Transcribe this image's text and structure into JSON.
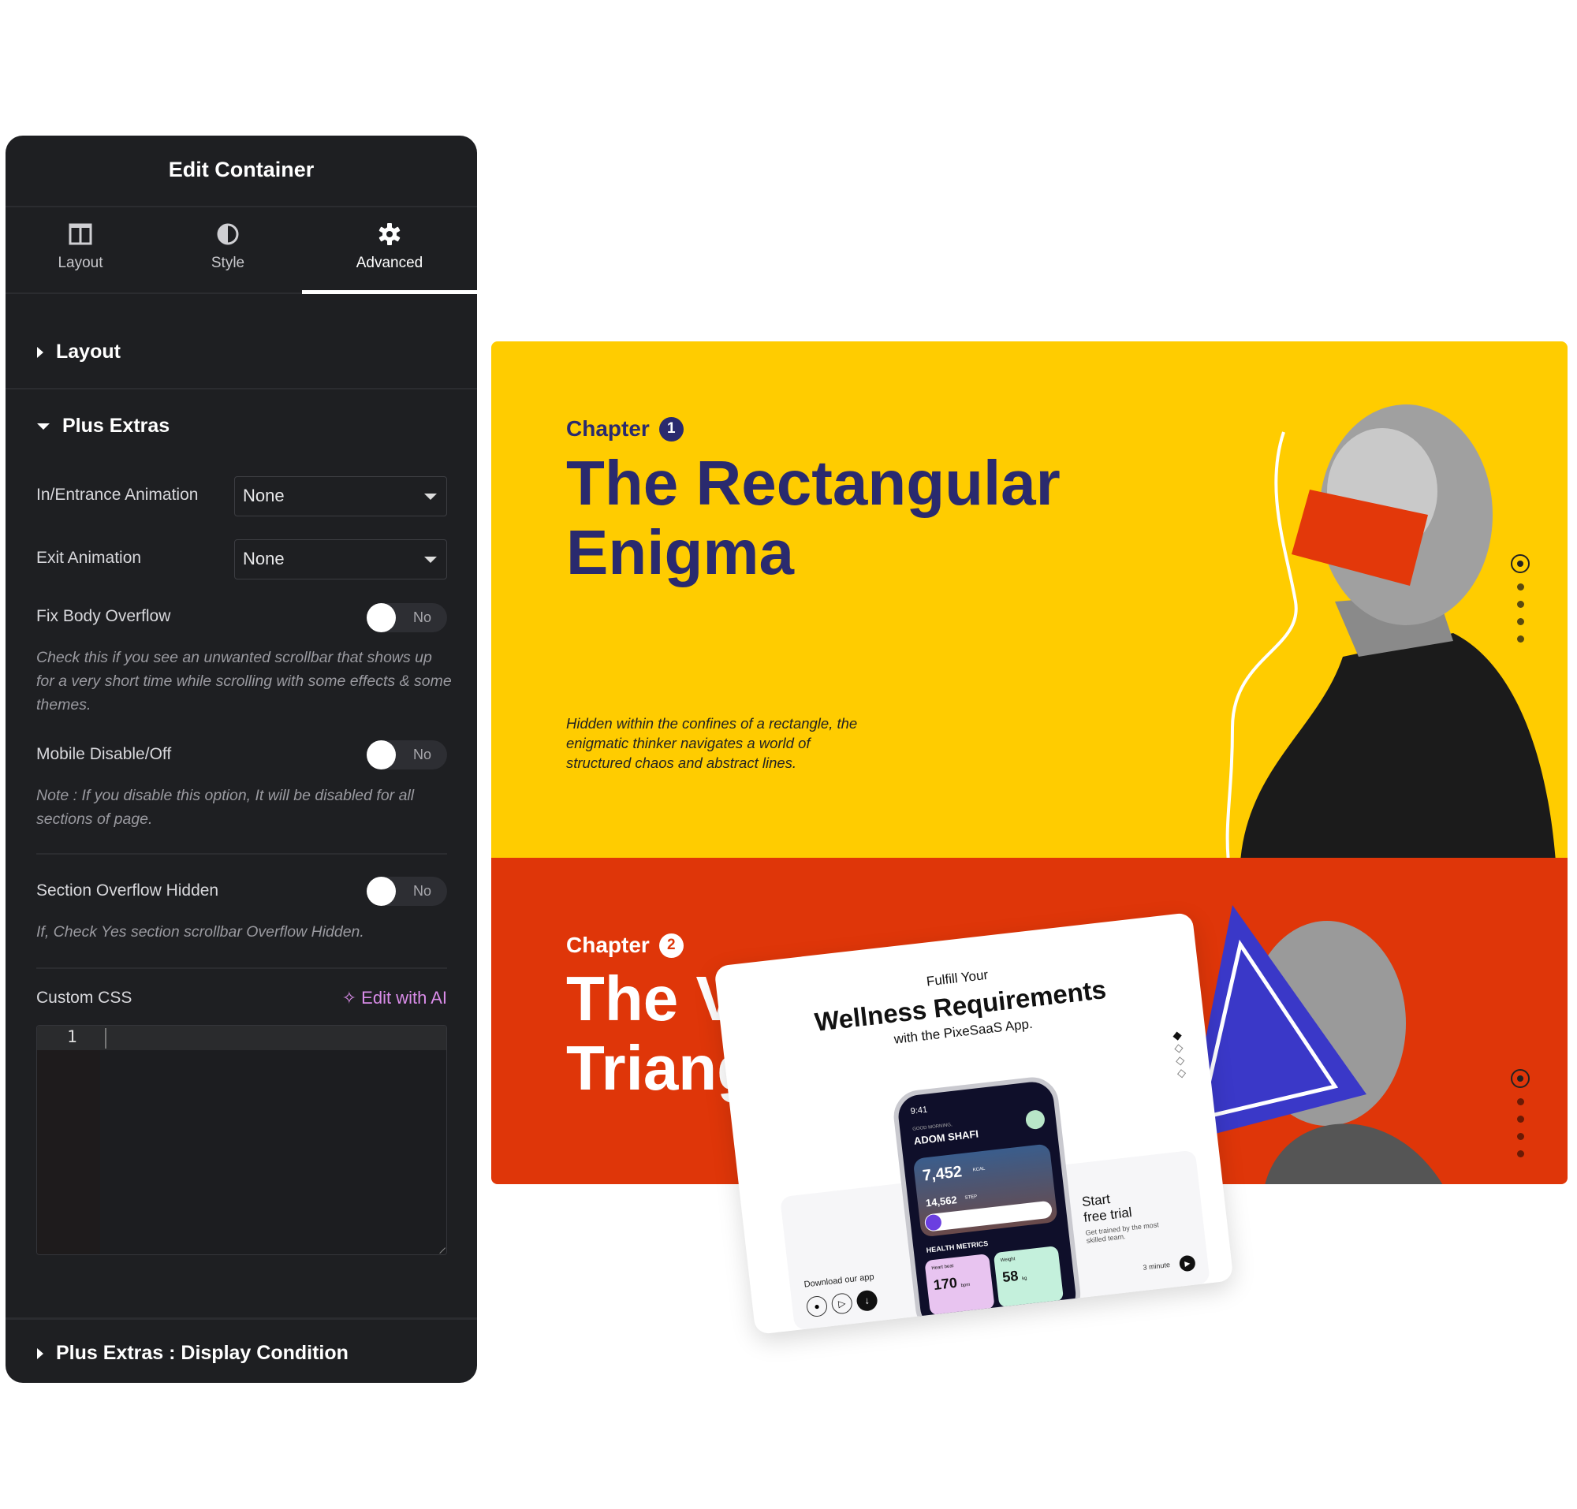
{
  "panel": {
    "title": "Edit Container",
    "tabs": [
      {
        "label": "Layout",
        "icon": "columns-icon"
      },
      {
        "label": "Style",
        "icon": "half-circle-icon"
      },
      {
        "label": "Advanced",
        "icon": "gear-icon",
        "active": true
      }
    ],
    "sections": {
      "layout": "Layout",
      "plus_extras": "Plus Extras",
      "display_condition": "Plus Extras : Display Condition"
    },
    "entrance_animation": {
      "label": "In/Entrance Animation",
      "value": "None"
    },
    "exit_animation": {
      "label": "Exit Animation",
      "value": "None"
    },
    "fix_body_overflow": {
      "label": "Fix Body Overflow",
      "state": "No",
      "desc": "Check this if you see an unwanted scrollbar that shows up for a very short time while scrolling with some effects & some themes."
    },
    "mobile_disable": {
      "label": "Mobile Disable/Off",
      "state": "No",
      "desc": "Note : If you disable this option, It will be disabled for all sections of page."
    },
    "section_overflow": {
      "label": "Section Overflow Hidden",
      "state": "No",
      "desc": "If, Check Yes section scrollbar Overflow Hidden."
    },
    "custom_css": {
      "label": "Custom CSS",
      "ai_label": "Edit with AI",
      "line_number": "1"
    }
  },
  "canvas": {
    "colors": {
      "yellow": "#ffcc00",
      "navy": "#2a2a6e",
      "red": "#df3609",
      "blue": "#3a38c8"
    },
    "chapter1": {
      "label": "Chapter",
      "number": "1",
      "title_line1": "The Rectangular",
      "title_line2": "Enigma",
      "desc": "Hidden within the confines of a rectangle, the enigmatic thinker navigates a world of structured chaos and abstract lines."
    },
    "chapter2": {
      "label": "Chapter",
      "number": "2",
      "title_line1": "The V",
      "title_line2": "Triang"
    },
    "mockup": {
      "kicker": "Fulfill Your",
      "title": "Wellness Requirements",
      "subtitle": "with the PixeSaaS App.",
      "time": "9:41",
      "greeting": "GOOD MORNING,",
      "user": "ADOM SHAFI",
      "kcal": "7,452",
      "kcal_unit": "KCAL",
      "steps": "14,562",
      "steps_unit": "STEP",
      "metrics_title": "HEALTH METRICS",
      "heart_label": "Heart beat",
      "heart_value": "170",
      "heart_unit": "bpm",
      "weight_label": "Weight",
      "weight_value": "58",
      "weight_unit": "kg",
      "cta_line1": "Start",
      "cta_line2": "free trial",
      "cta_desc": "Get trained by the most skilled team.",
      "duration": "3 minute",
      "download": "Download our app"
    }
  }
}
